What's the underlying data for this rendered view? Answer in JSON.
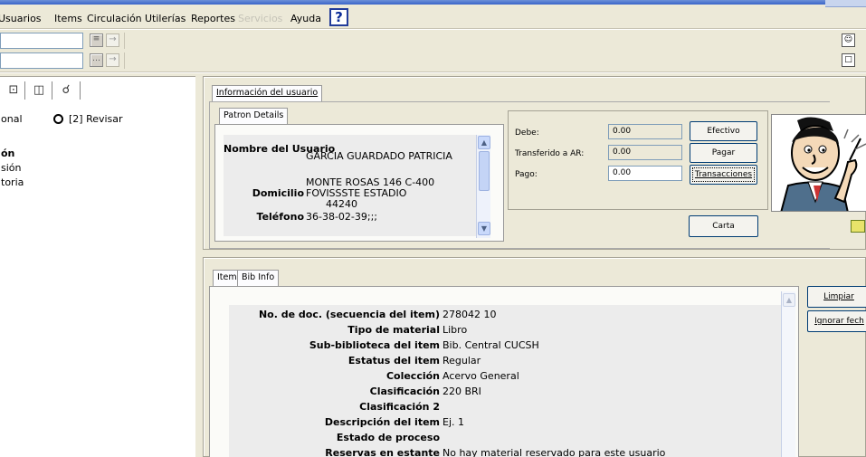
{
  "menu": {
    "items": [
      "Usuarios",
      "Items",
      "Circulación",
      "Utilerías",
      "Reportes",
      "Servicios",
      "Ayuda"
    ],
    "help_label": "?"
  },
  "toolbar": {
    "row1_btn": "≡",
    "row2_btn": "…",
    "arrow": "→"
  },
  "left_panel": {
    "radio_left_label": "onal",
    "radio_label": "[2] Revisar",
    "tree": [
      "ón",
      "sión",
      "toria"
    ]
  },
  "user_info": {
    "tab": "Información del usuario",
    "subtab": "Patron Details",
    "name_label": "Nombre del Usuario",
    "name_value": "GARCIA GUARDADO PATRICIA",
    "address_label": "Domicilio",
    "address_line1": "MONTE ROSAS 146 C-400",
    "address_line2": "FOVISSSTE ESTADIO",
    "address_line3": "44240",
    "phone_label": "Teléfono",
    "phone_value": "36-38-02-39;;;"
  },
  "balance": {
    "debe_label": "Debe:",
    "debe_value": "0.00",
    "transferido_label": "Transferido a AR:",
    "transferido_value": "0.00",
    "pago_label": "Pago:",
    "pago_value": "0.00",
    "efectivo_btn": "Efectivo",
    "pagar_btn": "Pagar",
    "transacciones_btn": "Transacciones",
    "carta_btn": "Carta"
  },
  "item_panel": {
    "tabs": [
      "Item",
      "Bib Info"
    ],
    "limpiar_btn": "Limpiar",
    "ignorar_btn": "Ignorar fech",
    "rows": [
      {
        "label": "No. de doc. (secuencia del item)",
        "value": "278042 10"
      },
      {
        "label": "Tipo de material",
        "value": "Libro"
      },
      {
        "label": "Sub-biblioteca del item",
        "value": "Bib. Central CUCSH"
      },
      {
        "label": "Estatus del item",
        "value": "Regular"
      },
      {
        "label": "Colección",
        "value": "Acervo General"
      },
      {
        "label": "Clasificación",
        "value": "220 BRI"
      },
      {
        "label": "Clasificación 2",
        "value": ""
      },
      {
        "label": "Descripción del item",
        "value": "Ej. 1"
      },
      {
        "label": "Estado de proceso",
        "value": ""
      },
      {
        "label": "Reservas en estante",
        "value": "No hay material reservado para este usuario"
      }
    ]
  },
  "colors": {
    "panel_bg": "#ece9d8",
    "xp_blue": "#3964c8",
    "button_border": "#003c74"
  }
}
